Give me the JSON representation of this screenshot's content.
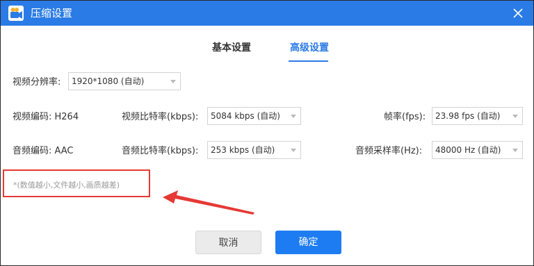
{
  "window": {
    "title": "压缩设置"
  },
  "tabs": [
    {
      "label": "基本设置"
    },
    {
      "label": "高级设置"
    }
  ],
  "active_tab": "高级设置",
  "settings": {
    "resolution": {
      "label": "视频分辨率:",
      "value": "1920*1080 (自动)"
    },
    "video_codec": {
      "label": "视频编码: H264"
    },
    "video_bitrate": {
      "label": "视频比特率(kbps):",
      "value": "5084 kbps (自动)"
    },
    "fps": {
      "label": "帧率(fps):",
      "value": "23.98 fps (自动)"
    },
    "audio_codec": {
      "label": "音频编码: AAC"
    },
    "audio_bitrate": {
      "label": "音频比特率(kbps):",
      "value": "253 kbps (自动)"
    },
    "sample_rate": {
      "label": "音频采样率(Hz):",
      "value": "48000 Hz (自动)"
    }
  },
  "note": "*(数值越小,文件越小,画质越差)",
  "buttons": {
    "cancel": "取消",
    "ok": "确定"
  },
  "colors": {
    "titlebar": "#2b7be6",
    "accent": "#2b7be6",
    "ok_button": "#1e7cf2",
    "annotation": "#e53935"
  }
}
